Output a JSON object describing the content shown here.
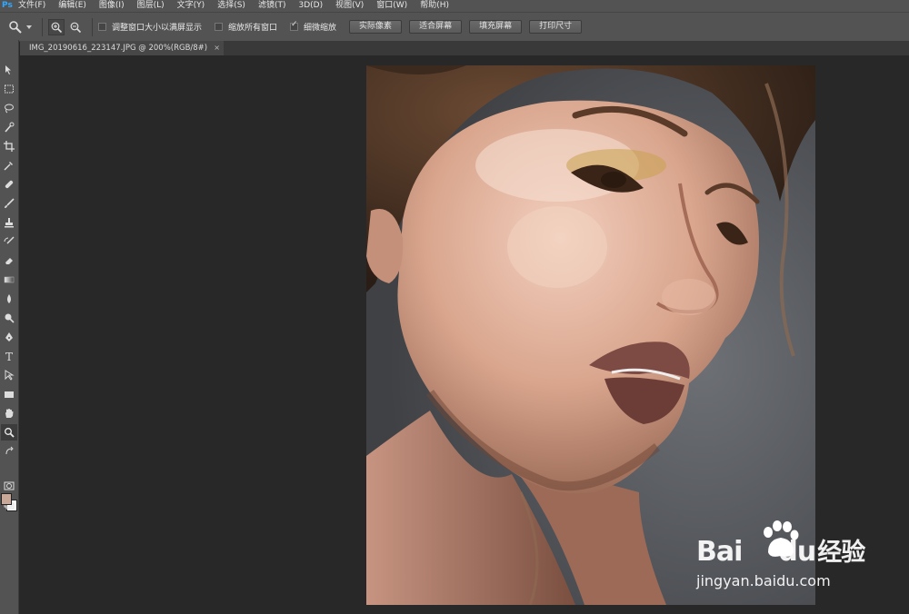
{
  "app": {
    "logo": "Ps"
  },
  "menu": [
    "文件(F)",
    "编辑(E)",
    "图像(I)",
    "图层(L)",
    "文字(Y)",
    "选择(S)",
    "滤镜(T)",
    "3D(D)",
    "视图(V)",
    "窗口(W)",
    "帮助(H)"
  ],
  "options": {
    "checkbox_resize_windows": {
      "label": "调整窗口大小以满屏显示",
      "checked": false
    },
    "checkbox_zoom_all": {
      "label": "缩放所有窗口",
      "checked": false
    },
    "checkbox_scrubby_zoom": {
      "label": "细微缩放",
      "checked": true
    },
    "btn_actual_pixels": "实际像素",
    "btn_fit_screen": "适合屏幕",
    "btn_fill_screen": "填充屏幕",
    "btn_print_size": "打印尺寸"
  },
  "document": {
    "tab_title": "IMG_20190616_223147.JPG @ 200%(RGB/8#)",
    "close_glyph": "×"
  },
  "colors": {
    "foreground": "#c8a898",
    "background": "#ffffff",
    "accent": "#31a8ff"
  },
  "tools": [
    "move-tool",
    "marquee-tool",
    "lasso-tool",
    "quick-select-tool",
    "crop-tool",
    "eyedropper-tool",
    "healing-brush-tool",
    "brush-tool",
    "clone-stamp-tool",
    "history-brush-tool",
    "eraser-tool",
    "gradient-tool",
    "blur-tool",
    "dodge-tool",
    "pen-tool",
    "type-tool",
    "path-select-tool",
    "rectangle-tool",
    "hand-tool",
    "zoom-tool"
  ],
  "watermark": {
    "logo_left": "Bai",
    "logo_right": "du",
    "logo_suffix": "经验",
    "url": "jingyan.baidu.com"
  }
}
